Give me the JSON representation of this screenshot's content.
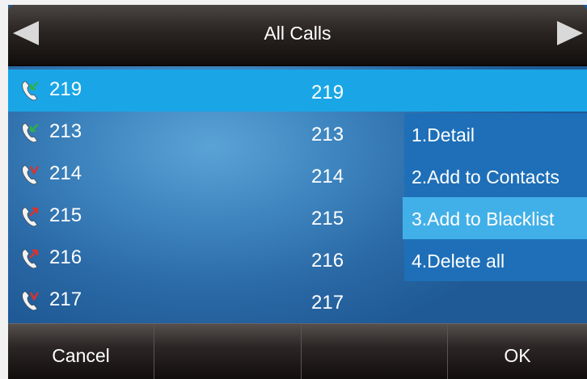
{
  "header": {
    "title": "All Calls",
    "prev_icon": "arrow-left-icon",
    "next_icon": "arrow-right-icon"
  },
  "calls": [
    {
      "name": "219",
      "number": "219",
      "type": "received",
      "accent": "#2db04a",
      "selected": true
    },
    {
      "name": "213",
      "number": "213",
      "type": "received",
      "accent": "#2db04a"
    },
    {
      "name": "214",
      "number": "214",
      "type": "missed",
      "accent": "#e0302a"
    },
    {
      "name": "215",
      "number": "215",
      "type": "dialed",
      "accent": "#e0302a"
    },
    {
      "name": "216",
      "number": "216",
      "type": "dialed",
      "accent": "#e0302a"
    },
    {
      "name": "217",
      "number": "217",
      "type": "missed",
      "accent": "#e0302a"
    }
  ],
  "menu": {
    "items": [
      "1.Detail",
      "2.Add to Contacts",
      "3.Add to Blacklist",
      "4.Delete all"
    ],
    "highlighted_index": 2
  },
  "softkeys": [
    "Cancel",
    "",
    "",
    "OK"
  ],
  "colors": {
    "selected_row": "#1aa6e6",
    "menu_bg": "#1e6fb8",
    "menu_highlight": "#42b0e8"
  }
}
